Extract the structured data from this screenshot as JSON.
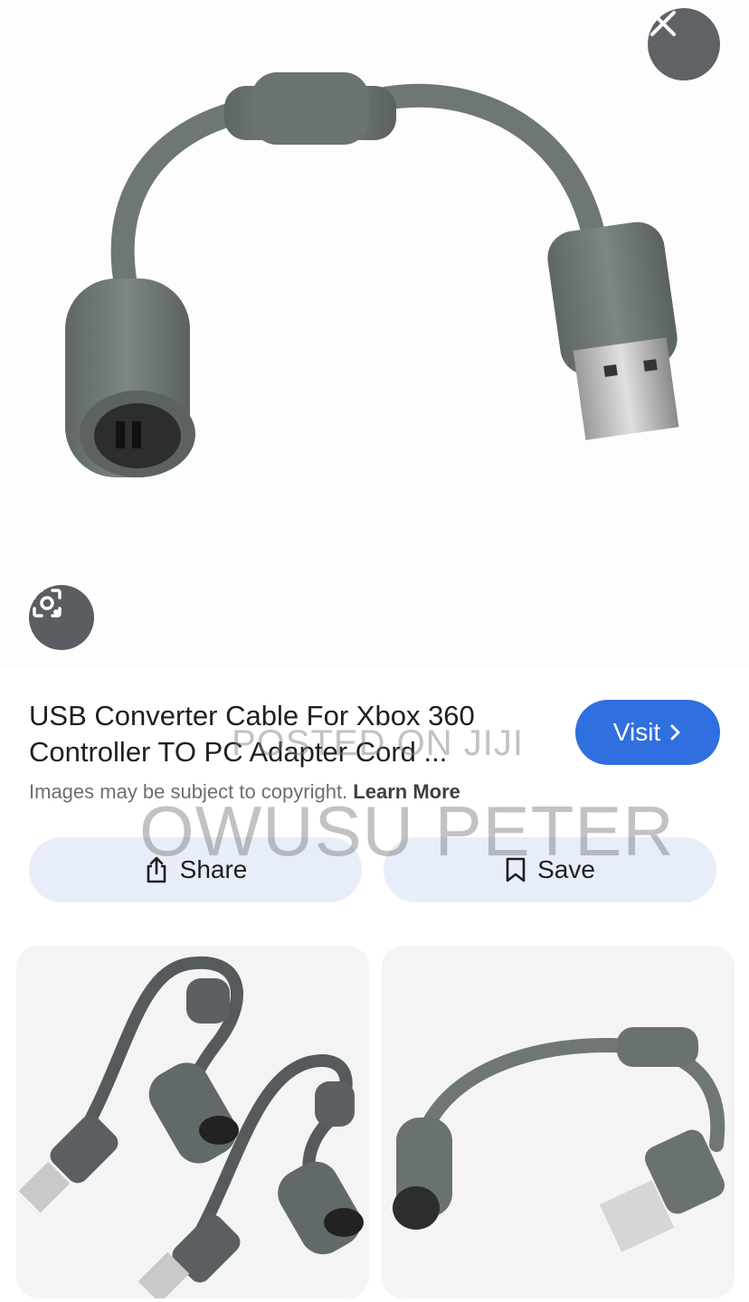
{
  "hero": {
    "close_icon": "close-icon",
    "lens_icon": "lens-icon"
  },
  "result": {
    "title_line1": "USB Converter Cable For Xbox 360",
    "title_line2": "Controller TO PC Adapter Cord ...",
    "visit_label": "Visit",
    "copyright_text": "Images may be subject to copyright.",
    "learn_more": "Learn More",
    "share_label": "Share",
    "save_label": "Save"
  },
  "watermark": {
    "line1": "POSTED ON JIJI",
    "line2": "OWUSU PETER"
  },
  "colors": {
    "accent": "#2f6fe0",
    "pill_bg": "#e7edf9",
    "cable": "#6f7676"
  }
}
